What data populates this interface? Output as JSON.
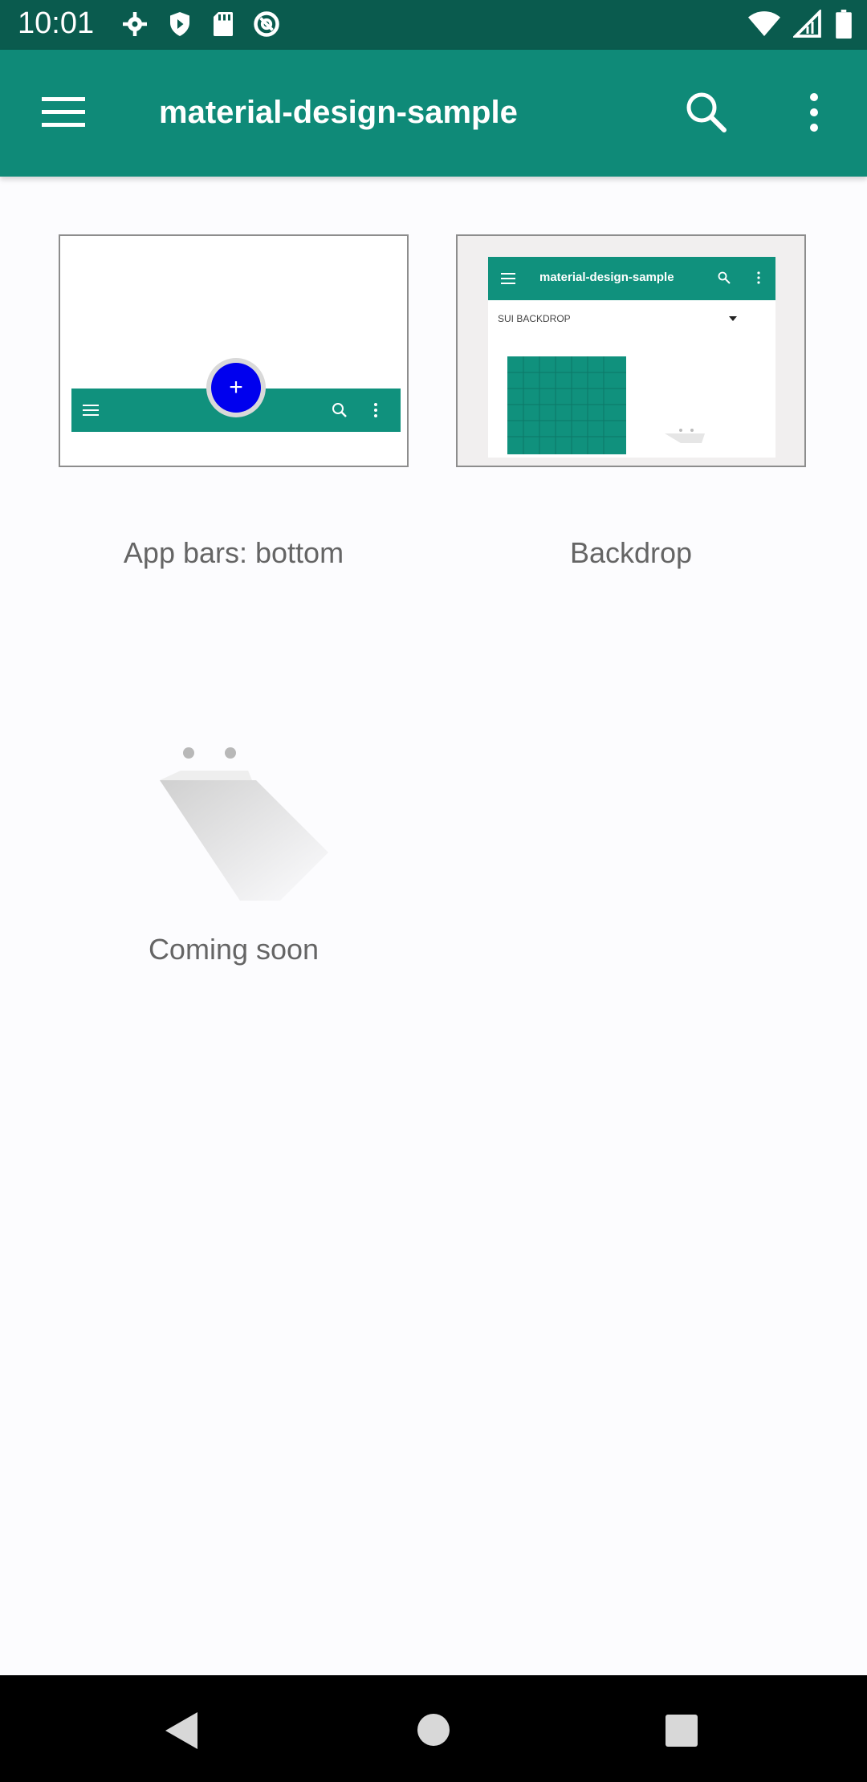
{
  "status_bar": {
    "time": "10:01",
    "icons_left": [
      "settings-icon",
      "shield-play-icon",
      "sd-card-icon",
      "at-sign-icon"
    ],
    "icons_right": [
      "wifi-icon",
      "cell-signal-icon",
      "battery-icon"
    ]
  },
  "app_bar": {
    "title": "material-design-sample",
    "menu_icon": "menu-icon",
    "search_icon": "search-icon",
    "more_icon": "more-vert-icon"
  },
  "cards": [
    {
      "label": "App bars: bottom",
      "preview": "bottom-app-bar-preview"
    },
    {
      "label": "Backdrop",
      "preview": "backdrop-preview",
      "preview_title": "material-design-sample",
      "preview_select": "SUI BACKDROP"
    },
    {
      "label": "Coming soon",
      "preview": "placeholder-preview"
    }
  ],
  "colors": {
    "status_bar": "#0a5b4e",
    "app_bar": "#0f8a78",
    "teal": "#10917d",
    "fab": "#0000ee",
    "background": "#fcfcfe"
  },
  "nav_bar": {
    "icons": [
      "back-icon",
      "home-icon",
      "recents-icon"
    ]
  }
}
